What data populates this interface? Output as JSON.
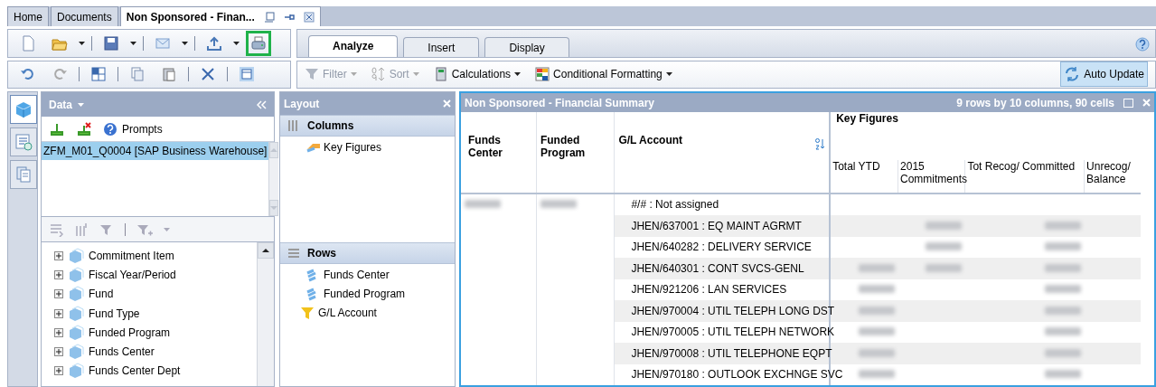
{
  "doc_tabs": [
    {
      "label": "Home",
      "selected": false
    },
    {
      "label": "Documents",
      "selected": false
    },
    {
      "label": "Non Sponsored - Finan...",
      "selected": true
    }
  ],
  "toolbar": {
    "print_highlighted": true
  },
  "ribbon_tabs": [
    {
      "label": "Analyze",
      "selected": true
    },
    {
      "label": "Insert",
      "selected": false
    },
    {
      "label": "Display",
      "selected": false
    }
  ],
  "ribbon_tools": [
    {
      "label": "Filter",
      "disabled": true,
      "kind": "filter"
    },
    {
      "label": "Sort",
      "disabled": true,
      "kind": "sort"
    },
    {
      "label": "Calculations",
      "disabled": false,
      "kind": "calc"
    },
    {
      "label": "Conditional Formatting",
      "disabled": false,
      "kind": "format"
    }
  ],
  "auto_update": {
    "label": "Auto Update",
    "on": true
  },
  "side_tabs": [
    {
      "kind": "cube",
      "selected": true
    },
    {
      "kind": "list",
      "selected": false
    },
    {
      "kind": "pages",
      "selected": false
    }
  ],
  "data_panel": {
    "title": "Data",
    "prompts": "Prompts",
    "sources": [
      {
        "label": "ZFM_M01_Q0004 [SAP Business Warehouse]",
        "selected": true
      }
    ],
    "fields": [
      {
        "label": "Commitment Item",
        "expanded": false
      },
      {
        "label": "Fiscal Year/Period",
        "expanded": false
      },
      {
        "label": "Fund",
        "expanded": false
      },
      {
        "label": "Fund Type",
        "expanded": false
      },
      {
        "label": "Funded Program",
        "expanded": false
      },
      {
        "label": "Funds Center",
        "expanded": false
      },
      {
        "label": "Funds Center Dept",
        "expanded": false
      }
    ]
  },
  "layout_panel": {
    "title": "Layout",
    "columns": {
      "label": "Columns",
      "items": [
        {
          "label": "Key Figures",
          "kind": "keyfigure"
        }
      ]
    },
    "rows": {
      "label": "Rows",
      "items": [
        {
          "label": "Funds Center",
          "kind": "dimension"
        },
        {
          "label": "Funded Program",
          "kind": "dimension"
        },
        {
          "label": "G/L Account",
          "kind": "filtered"
        }
      ]
    }
  },
  "report": {
    "title": "Non Sponsored - Financial Summary",
    "info": "9 rows by 10 columns, 90 cells",
    "row_headers": [
      "Funds Center",
      "Funded Program",
      "G/L Account"
    ],
    "group_header": "Key Figures",
    "figure_columns": [
      "Total YTD",
      "2015 Commitments",
      "Tot Recog/ Committed",
      "Unrecog/ Balance"
    ],
    "rows": [
      {
        "account": "#/# : Not assigned",
        "masked": [
          true,
          true,
          false,
          false,
          false,
          false
        ]
      },
      {
        "account": "JHEN/637001 : EQ MAINT AGRMT",
        "masked": [
          false,
          false,
          false,
          true,
          true,
          false
        ]
      },
      {
        "account": "JHEN/640282 : DELIVERY SERVICE",
        "masked": [
          false,
          false,
          false,
          true,
          true,
          false
        ]
      },
      {
        "account": "JHEN/640301 : CONT SVCS-GENL",
        "masked": [
          false,
          false,
          true,
          true,
          true,
          false
        ]
      },
      {
        "account": "JHEN/921206 : LAN SERVICES",
        "masked": [
          false,
          false,
          true,
          false,
          true,
          false
        ]
      },
      {
        "account": "JHEN/970004 : UTIL TELEPH LONG DST",
        "masked": [
          false,
          false,
          true,
          false,
          true,
          false
        ]
      },
      {
        "account": "JHEN/970005 : UTIL TELEPH NETWORK",
        "masked": [
          false,
          false,
          true,
          false,
          true,
          false
        ]
      },
      {
        "account": "JHEN/970008 : UTIL TELEPHONE EQPT",
        "masked": [
          false,
          false,
          true,
          false,
          true,
          false
        ]
      },
      {
        "account": "JHEN/970180 : OUTLOOK EXCHNGE SVC",
        "masked": [
          false,
          false,
          true,
          false,
          true,
          false
        ]
      }
    ]
  }
}
